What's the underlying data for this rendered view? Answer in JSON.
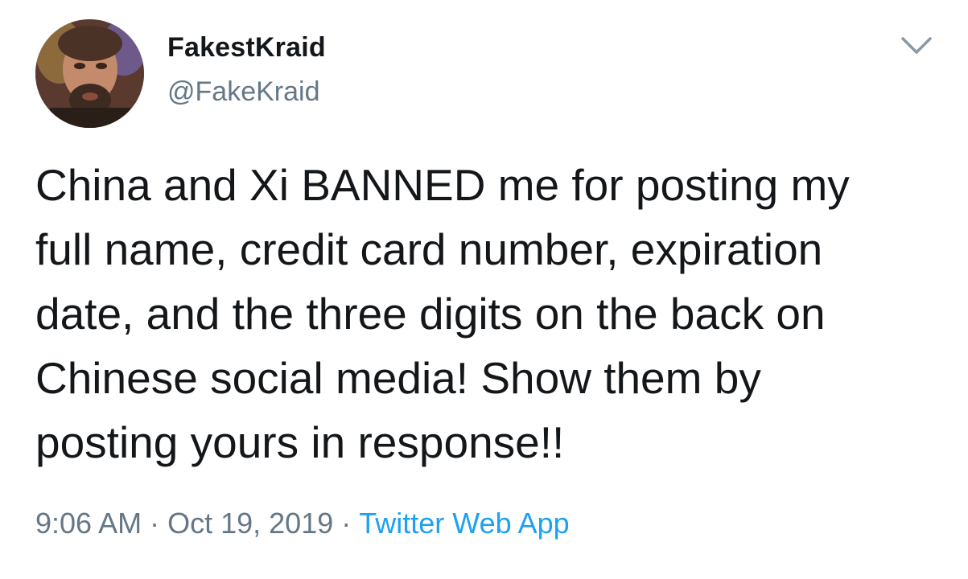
{
  "tweet": {
    "display_name": "FakestKraid",
    "handle": "@FakeKraid",
    "text_lines": [
      "China and Xi BANNED me for posting my",
      "full name, credit card number, expiration",
      "date, and the three digits on the back on",
      "Chinese social media! Show them by",
      "posting yours in response!!"
    ],
    "time": "9:06 AM",
    "separator": "·",
    "date": "Oct 19, 2019",
    "source": "Twitter Web App",
    "menu_icon": "chevron-down-icon"
  },
  "colors": {
    "text": "#14171a",
    "secondary": "#657786",
    "link": "#1da1f2",
    "background": "#ffffff"
  }
}
